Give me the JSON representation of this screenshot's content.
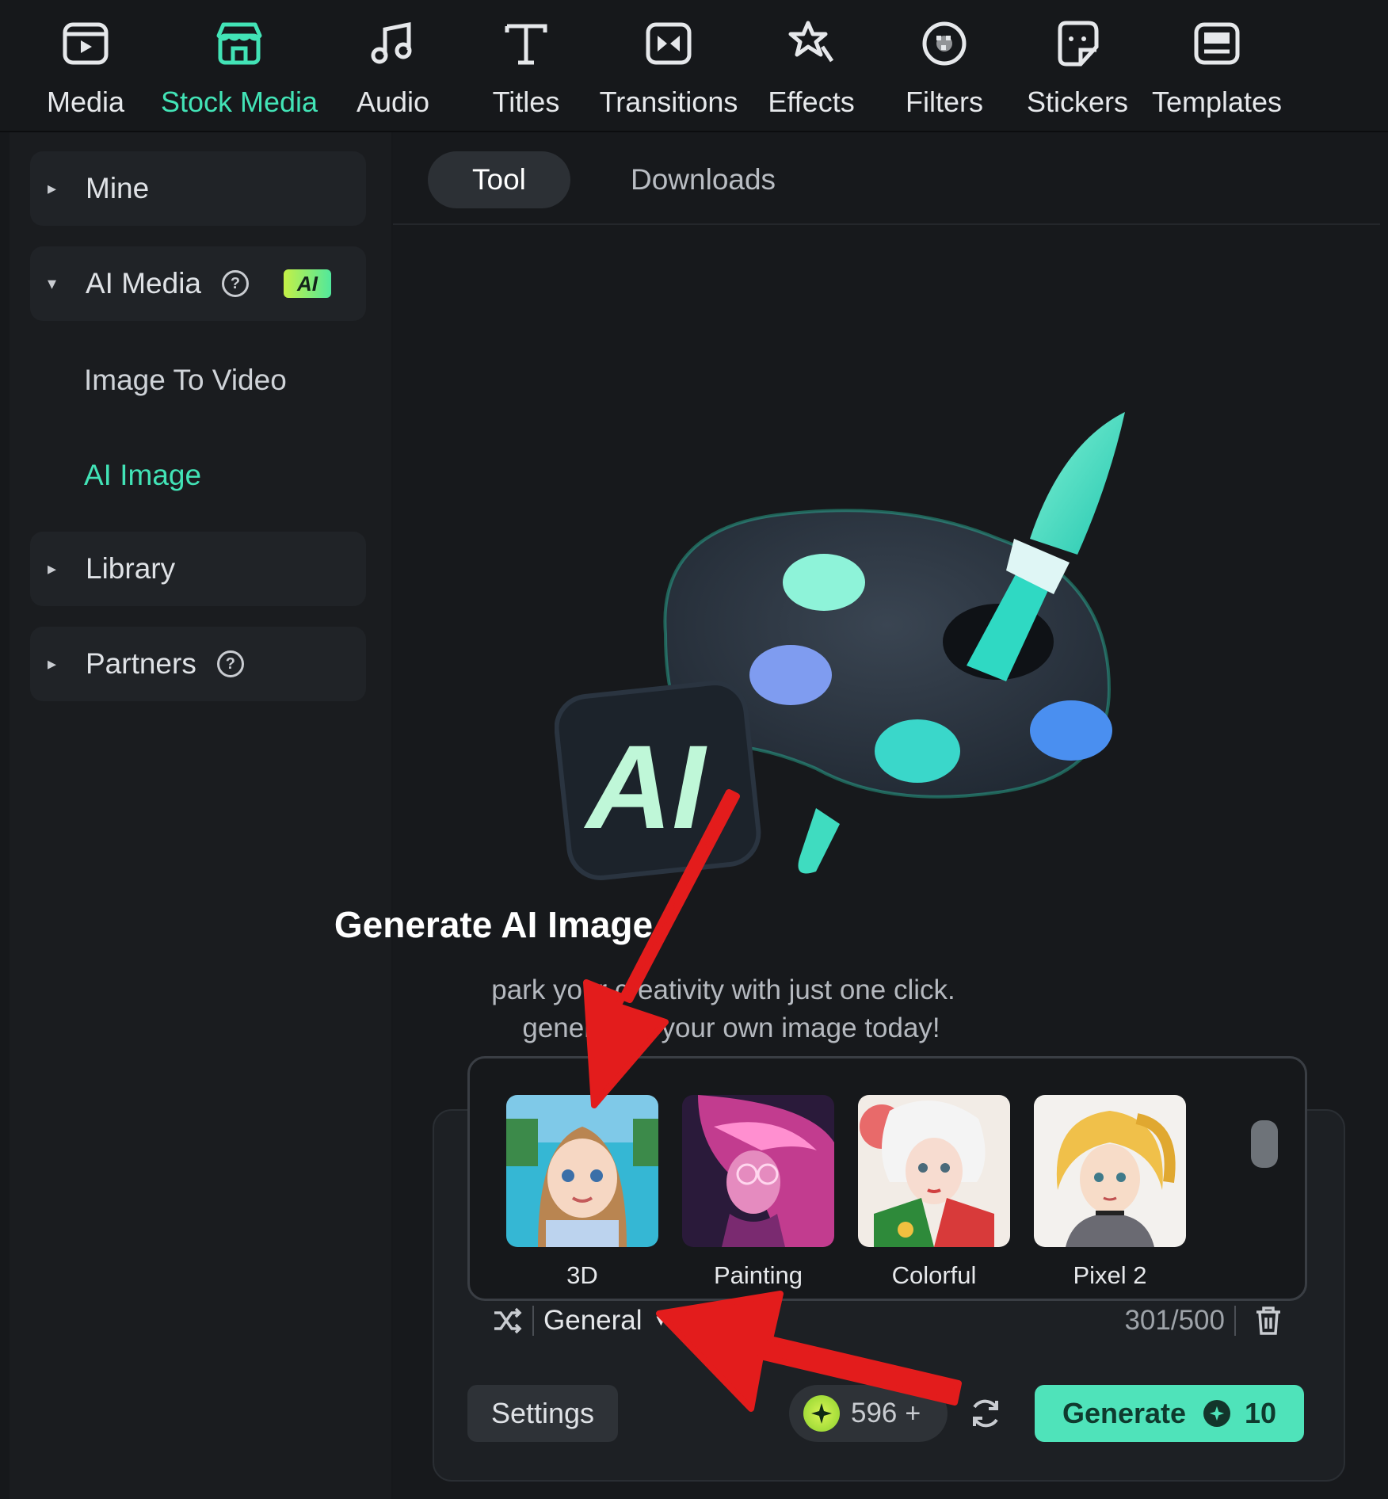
{
  "toolbar": {
    "tabs": [
      {
        "label": "Media",
        "icon": "media-icon"
      },
      {
        "label": "Stock Media",
        "icon": "stock-media-icon",
        "active": true
      },
      {
        "label": "Audio",
        "icon": "music-note-icon"
      },
      {
        "label": "Titles",
        "icon": "text-t-icon"
      },
      {
        "label": "Transitions",
        "icon": "transition-icon"
      },
      {
        "label": "Effects",
        "icon": "effects-star-icon"
      },
      {
        "label": "Filters",
        "icon": "filters-icon"
      },
      {
        "label": "Stickers",
        "icon": "sticker-icon"
      },
      {
        "label": "Templates",
        "icon": "templates-icon"
      }
    ]
  },
  "sidebar": {
    "mine": "Mine",
    "ai_media": "AI Media",
    "ai_badge": "AI",
    "image_to_video": "Image To Video",
    "ai_image": "AI Image",
    "library": "Library",
    "partners": "Partners"
  },
  "main": {
    "tab_tool": "Tool",
    "tab_downloads": "Downloads",
    "hero_badge": "AI",
    "title": "Generate AI Image",
    "subtitle_line1": "park your creativity with just one click.",
    "subtitle_line2": "generating your own image today!"
  },
  "styles": [
    {
      "label": "3D"
    },
    {
      "label": "Painting"
    },
    {
      "label": "Colorful"
    },
    {
      "label": "Pixel 2"
    }
  ],
  "prompt": {
    "category": "General",
    "char_count": "301/500"
  },
  "actions": {
    "settings": "Settings",
    "credits": "596",
    "credits_plus": "+",
    "generate": "Generate",
    "generate_cost": "10"
  },
  "colors": {
    "accent": "#42e3b6",
    "annotation_arrow": "#e31c1c"
  }
}
